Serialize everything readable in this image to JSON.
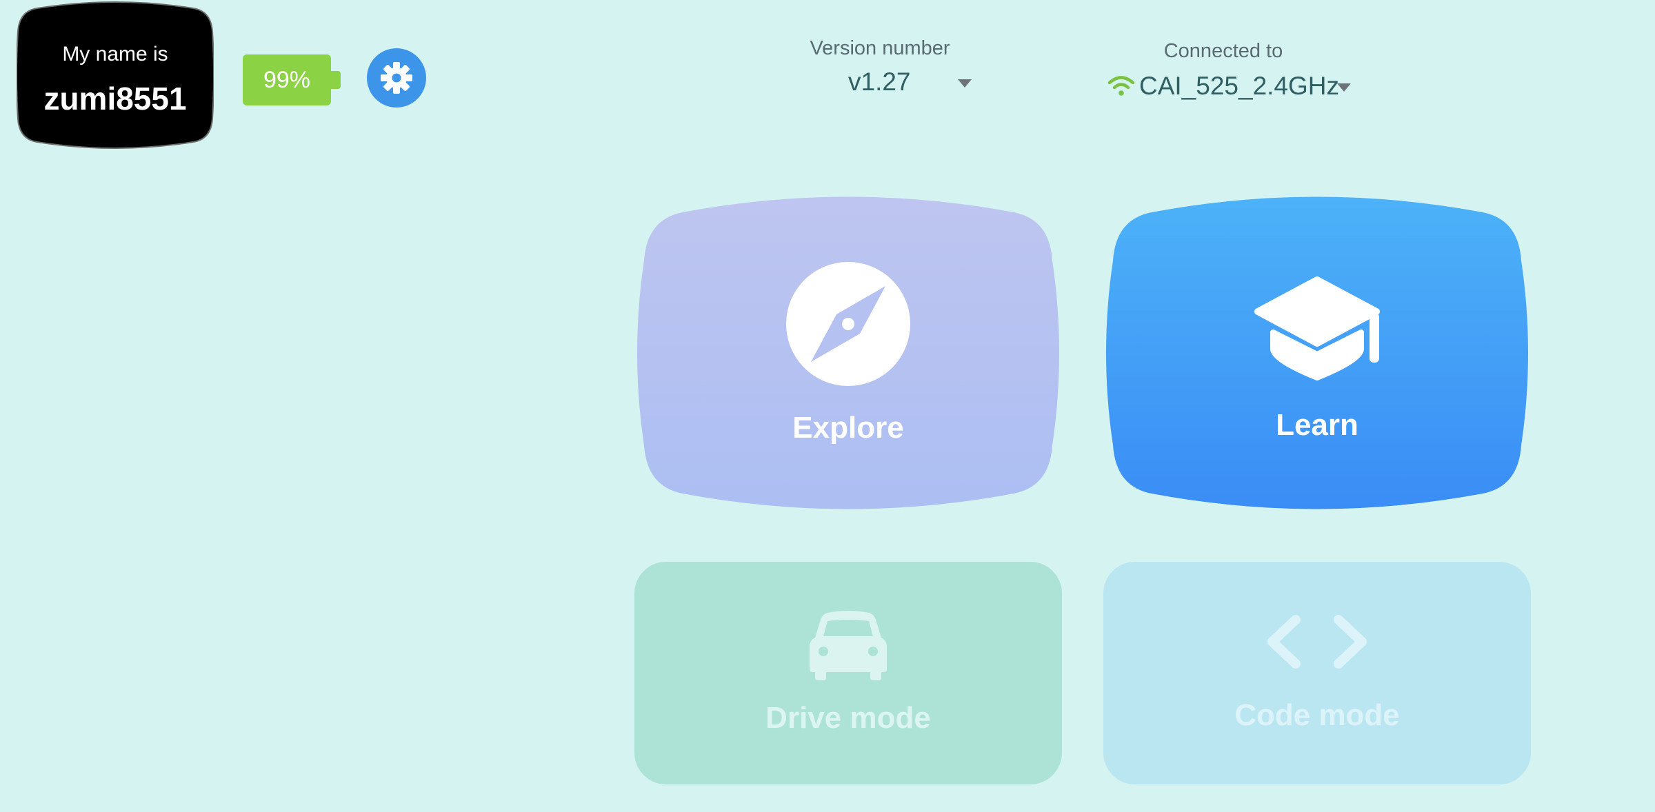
{
  "robot": {
    "name_label": "My name is",
    "name": "zumi8551"
  },
  "battery": {
    "percent_label": "99%",
    "level": 0.99
  },
  "settings": {
    "icon": "gear-icon"
  },
  "version": {
    "label": "Version number",
    "selected": "v1.27"
  },
  "connection": {
    "label": "Connected to",
    "network": "CAI_525_2.4GHz"
  },
  "modes": {
    "explore": {
      "label": "Explore",
      "icon": "compass-icon"
    },
    "learn": {
      "label": "Learn",
      "icon": "graduation-cap-icon"
    },
    "drive": {
      "label": "Drive mode",
      "icon": "car-icon"
    },
    "code": {
      "label": "Code mode",
      "icon": "code-brackets-icon"
    }
  },
  "colors": {
    "background": "#d4f3f1",
    "battery": "#8cd245",
    "settings": "#3d95ea",
    "explore_top": "#bdc5f0",
    "explore_bottom": "#adbff2",
    "learn_top": "#4db2f8",
    "learn_bottom": "#3a8ef5",
    "drive": "#ace3d6",
    "code": "#bae6f1",
    "wifi": "#7cc242"
  }
}
